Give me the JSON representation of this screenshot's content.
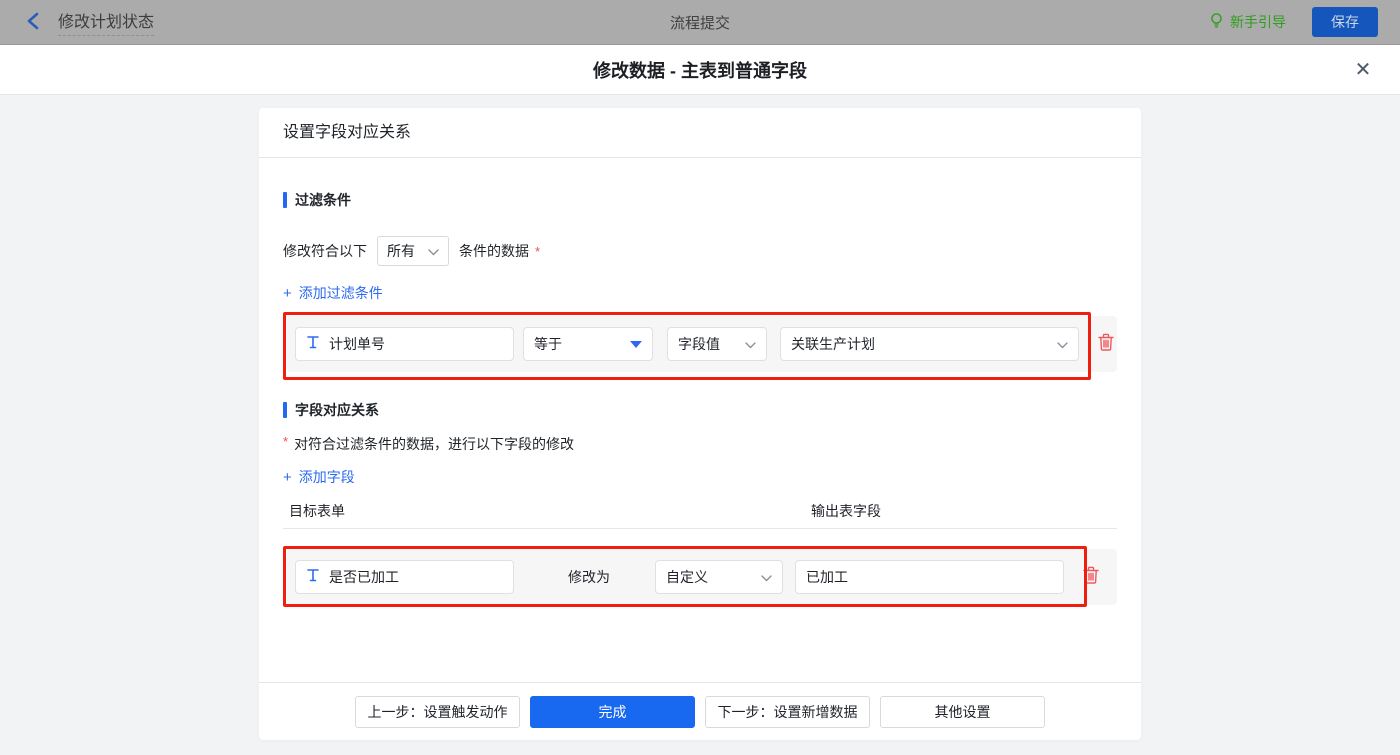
{
  "topbar": {
    "back_label": "修改计划状态",
    "center_title": "流程提交",
    "guide_label": "新手引导",
    "save_label": "保存"
  },
  "modal": {
    "title": "修改数据 - 主表到普通字段",
    "close_icon": "✕"
  },
  "panel": {
    "header": "设置字段对应关系",
    "filter_section": {
      "title": "过滤条件",
      "match_prefix": "修改符合以下",
      "match_select_value": "所有",
      "match_suffix": "条件的数据",
      "required_mark": "*",
      "add_link": "添加过滤条件",
      "plus": "+",
      "row": {
        "field": "计划单号",
        "operator": "等于",
        "value_type": "字段值",
        "value": "关联生产计划"
      }
    },
    "mapping_section": {
      "title": "字段对应关系",
      "required_mark": "*",
      "description": "对符合过滤条件的数据，进行以下字段的修改",
      "add_link": "添加字段",
      "plus": "+",
      "col_target": "目标表单",
      "col_output": "输出表字段",
      "row": {
        "field": "是否已加工",
        "modify_label": "修改为",
        "value_type": "自定义",
        "value": "已加工"
      }
    },
    "footer": {
      "prev": "上一步：设置触发动作",
      "done": "完成",
      "next": "下一步：设置新增数据",
      "other": "其他设置"
    }
  },
  "colors": {
    "accent_blue": "#1868f0",
    "link_blue": "#2d6af0",
    "annotation_red": "#f01e0e",
    "danger_red": "#f0595c",
    "guide_green": "#2f9e1e",
    "required_red": "#f54a45"
  }
}
